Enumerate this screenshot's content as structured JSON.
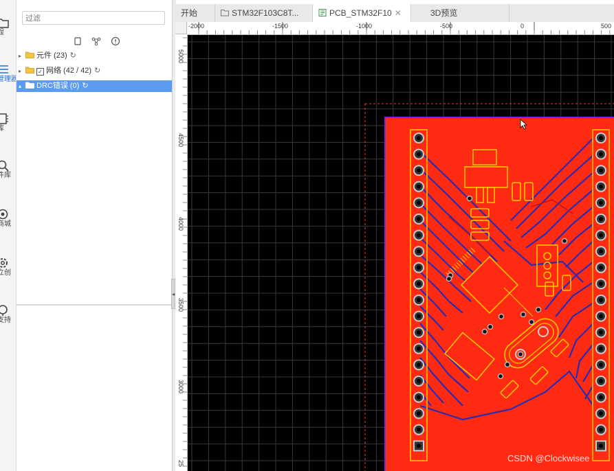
{
  "rail": {
    "items": [
      {
        "label": "程",
        "icon": "folder-icon"
      },
      {
        "label": "管理器",
        "icon": "list-icon"
      },
      {
        "label": "库",
        "icon": "library-icon"
      },
      {
        "label": "件库",
        "icon": "search-icon"
      },
      {
        "label": "商城",
        "icon": "shop-icon"
      },
      {
        "label": "立创",
        "icon": "gear-icon"
      },
      {
        "label": "支持",
        "icon": "help-icon"
      }
    ]
  },
  "panel": {
    "filter_placeholder": "过滤",
    "tree": [
      {
        "label": "元件 (23)",
        "checkbox": false,
        "selected": false
      },
      {
        "label": "网络 (42 / 42)",
        "checkbox": true,
        "selected": false
      },
      {
        "label": "DRC错误 (0)",
        "checkbox": false,
        "selected": true
      }
    ]
  },
  "tabs": [
    {
      "label": "开始",
      "icon": "none"
    },
    {
      "label": "STM32F103C8T...",
      "icon": "folder-icon"
    },
    {
      "label": "PCB_STM32F10",
      "icon": "pcb-icon",
      "active": true,
      "closable": true
    },
    {
      "label": "3D预览",
      "icon": "none"
    }
  ],
  "ruler": {
    "h_labels": [
      "-2000",
      "-1500",
      "-1000",
      "-500",
      "0",
      "500"
    ],
    "v_labels": [
      "5000",
      "4500",
      "4000",
      "3500",
      "3000",
      "25"
    ]
  },
  "watermark": "CSDN @Clockwisee",
  "colors": {
    "canvas_bg": "#000000",
    "grid": "#3a3a3a",
    "copper_top": "#ff2a12",
    "copper_bottom": "#2b2bb0",
    "silkscreen": "#ffcc00",
    "board_outline": "#ff3333",
    "selection": "#5b9bf0"
  }
}
